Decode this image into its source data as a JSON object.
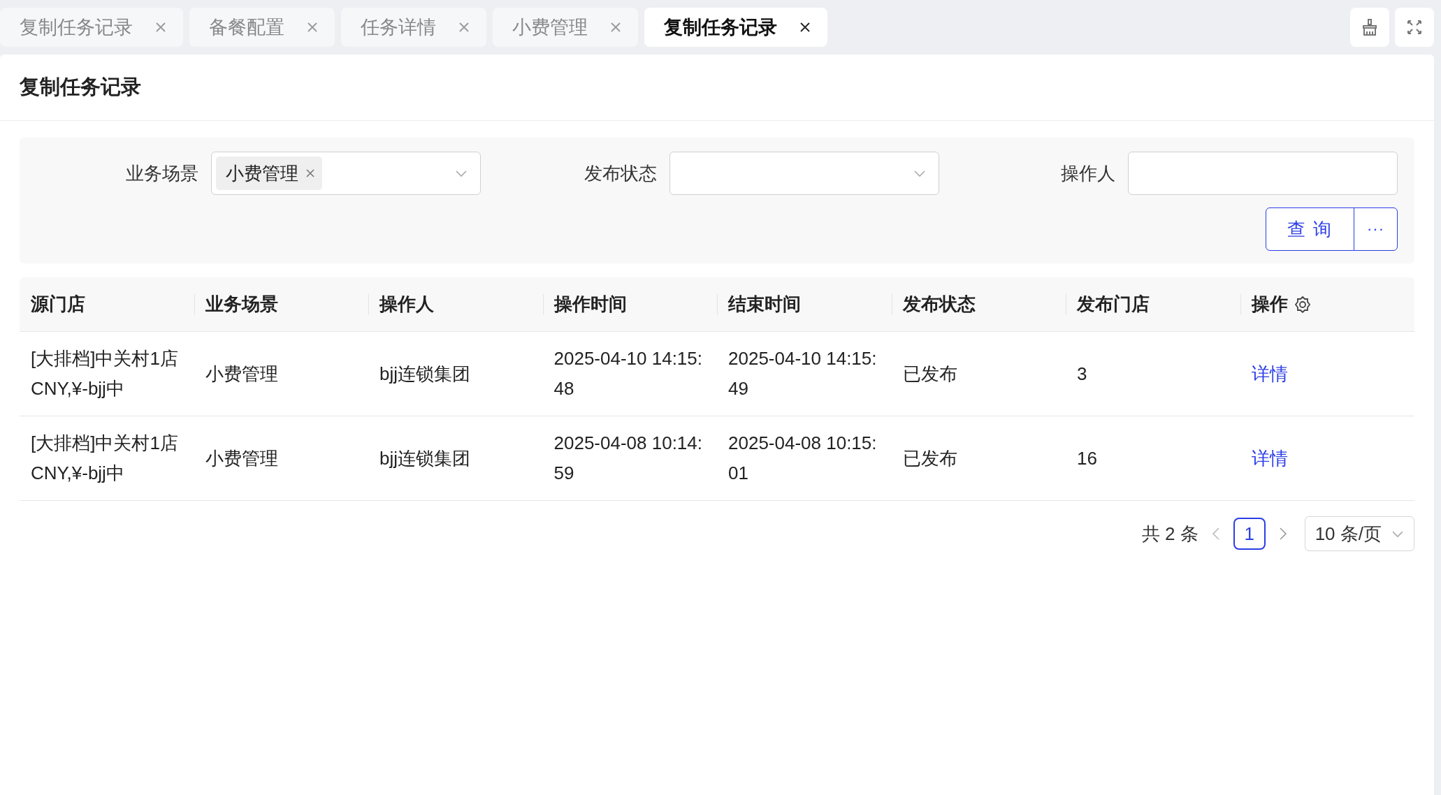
{
  "tabs": [
    {
      "label": "复制任务记录",
      "selected": false
    },
    {
      "label": "备餐配置",
      "selected": false
    },
    {
      "label": "任务详情",
      "selected": false
    },
    {
      "label": "小费管理",
      "selected": false
    },
    {
      "label": "复制任务记录",
      "selected": true
    }
  ],
  "page_title": "复制任务记录",
  "filters": [
    {
      "kind": "select",
      "label": "业务场景",
      "tags": [
        "小费管理"
      ]
    },
    {
      "kind": "select",
      "label": "发布状态"
    },
    {
      "kind": "input",
      "label": "操作人"
    }
  ],
  "buttons": {
    "query": "查 询",
    "more": "···"
  },
  "table": {
    "columns": [
      "源门店",
      "业务场景",
      "操作人",
      "操作时间",
      "结束时间",
      "发布状态",
      "发布门店",
      "操作"
    ],
    "rows": [
      {
        "cells": [
          "[大排档]中关村1店CNY,¥-bjj中",
          "小费管理",
          "bjj连锁集团",
          "2025-04-10 14:15:48",
          "2025-04-10 14:15:49",
          "已发布",
          "3"
        ],
        "action": "详情"
      },
      {
        "cells": [
          "[大排档]中关村1店CNY,¥-bjj中",
          "小费管理",
          "bjj连锁集团",
          "2025-04-08 10:14:59",
          "2025-04-08 10:15:01",
          "已发布",
          "16"
        ],
        "action": "详情"
      }
    ]
  },
  "pagination": {
    "total": "共 2 条",
    "pages": [
      {
        "label": "1",
        "selected": true
      }
    ],
    "page_size": "10 条/页"
  }
}
